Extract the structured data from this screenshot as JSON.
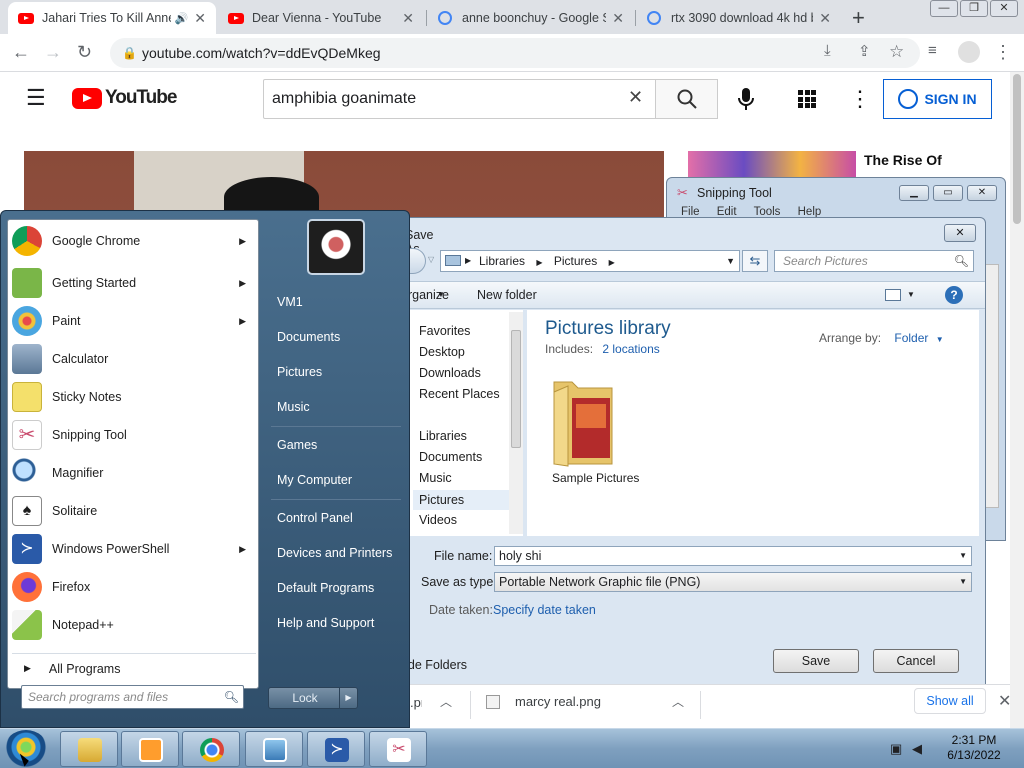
{
  "browser": {
    "tabs": [
      {
        "label": "Jahari Tries To Kill Anne",
        "icon": "youtube-icon"
      },
      {
        "label": "Dear Vienna - YouTube",
        "icon": "youtube-icon"
      },
      {
        "label": "anne boonchuy - Google S",
        "icon": "google-icon"
      },
      {
        "label": "rtx 3090 download 4k hd b",
        "icon": "google-icon"
      }
    ],
    "url": "youtube.com/watch?v=ddEvQDeMkeg"
  },
  "youtube": {
    "logo_text": "YouTube",
    "search_value": "amphibia goanimate",
    "signin_label": "SIGN IN",
    "related_title": "The Rise Of"
  },
  "start_menu": {
    "programs": [
      {
        "label": "Google Chrome",
        "submenu": true,
        "color": "#4285f4"
      },
      {
        "label": "Getting Started",
        "submenu": true,
        "color": "#7ab648"
      },
      {
        "label": "Paint",
        "submenu": true,
        "color": "#e8a33d"
      },
      {
        "label": "Calculator",
        "submenu": false,
        "color": "#6b86a8"
      },
      {
        "label": "Sticky Notes",
        "submenu": false,
        "color": "#f4e06b"
      },
      {
        "label": "Snipping Tool",
        "submenu": false,
        "color": "#c94b6d"
      },
      {
        "label": "Magnifier",
        "submenu": false,
        "color": "#4a7fb8"
      },
      {
        "label": "Solitaire",
        "submenu": false,
        "color": "#dfe7ee"
      },
      {
        "label": "Windows PowerShell",
        "submenu": true,
        "color": "#2a5aa8"
      },
      {
        "label": "Firefox",
        "submenu": false,
        "color": "#ff7139"
      },
      {
        "label": "Notepad++",
        "submenu": false,
        "color": "#8bc34a"
      }
    ],
    "all_programs": "All Programs",
    "search_placeholder": "Search programs and files",
    "right_links": [
      "VM1",
      "Documents",
      "Pictures",
      "Music",
      "Games",
      "My Computer",
      "Control Panel",
      "Devices and Printers",
      "Default Programs",
      "Help and Support"
    ],
    "lock_label": "Lock"
  },
  "snipping_tool": {
    "title": "Snipping Tool",
    "menu": [
      "File",
      "Edit",
      "Tools",
      "Help"
    ]
  },
  "save_dialog": {
    "title": "Save As",
    "breadcrumb": [
      "Libraries",
      "Pictures"
    ],
    "search_placeholder": "Search Pictures",
    "toolbar": {
      "organize": "Organize",
      "new_folder": "New folder"
    },
    "nav_items": [
      {
        "label": "Favorites",
        "group": true
      },
      {
        "label": "Desktop"
      },
      {
        "label": "Downloads"
      },
      {
        "label": "Recent Places"
      },
      {
        "label": "Libraries",
        "group": true
      },
      {
        "label": "Documents"
      },
      {
        "label": "Music"
      },
      {
        "label": "Pictures",
        "selected": true
      },
      {
        "label": "Videos"
      }
    ],
    "library_title": "Pictures library",
    "includes_label": "Includes:",
    "includes_link": "2 locations",
    "arrange_label": "Arrange by:",
    "arrange_value": "Folder",
    "folder_name": "Sample Pictures",
    "file_name_label": "File name:",
    "file_name": "holy shi",
    "save_type_label": "Save as type:",
    "save_type": "Portable Network Graphic file (PNG)",
    "date_taken_label": "Date taken:",
    "date_taken_link": "Specify date taken",
    "hide_folders": "Hide Folders",
    "save_button": "Save",
    "cancel_button": "Cancel"
  },
  "downloads": {
    "items": [
      {
        "label": ".png"
      },
      {
        "label": "marcy real.png"
      }
    ],
    "show_all": "Show all"
  },
  "taskbar": {
    "time": "2:31 PM",
    "date": "6/13/2022"
  }
}
